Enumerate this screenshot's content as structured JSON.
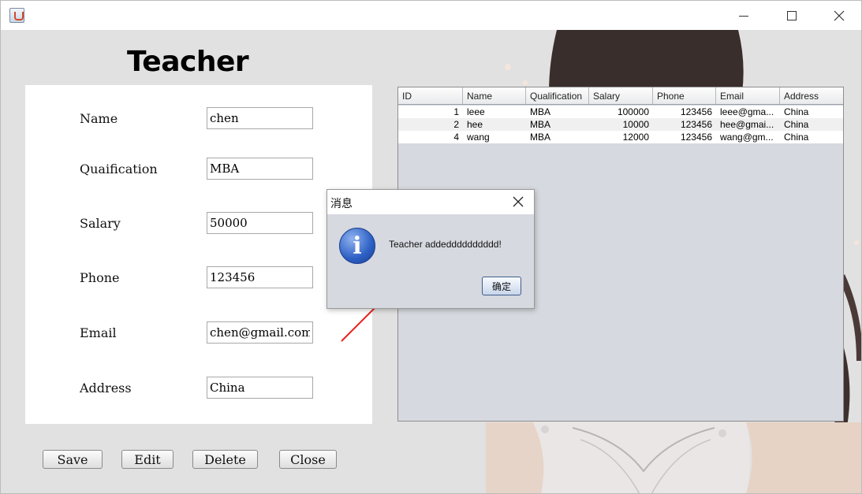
{
  "window": {
    "icon": "java-cup-icon",
    "controls": [
      "minimize-icon",
      "maximize-icon",
      "close-icon"
    ]
  },
  "page": {
    "title": "Teacher"
  },
  "form": {
    "fields": [
      {
        "label": "Name",
        "value": "chen"
      },
      {
        "label": "Quaification",
        "value": "MBA"
      },
      {
        "label": "Salary",
        "value": "50000"
      },
      {
        "label": "Phone",
        "value": "123456"
      },
      {
        "label": "Email",
        "value": "chen@gmail.com"
      },
      {
        "label": "Address",
        "value": "China"
      }
    ]
  },
  "buttons": {
    "save": "Save",
    "edit": "Edit",
    "delete": "Delete",
    "close": "Close"
  },
  "table": {
    "columns": [
      "ID",
      "Name",
      "Qualification",
      "Salary",
      "Phone",
      "Email",
      "Address"
    ],
    "rows": [
      [
        "1",
        "leee",
        "MBA",
        "100000",
        "123456",
        "leee@gma...",
        "China"
      ],
      [
        "2",
        "hee",
        "MBA",
        "10000",
        "123456",
        "hee@gmai...",
        "China"
      ],
      [
        "4",
        "wang",
        "MBA",
        "12000",
        "123456",
        "wang@gm...",
        "China"
      ]
    ]
  },
  "dialog": {
    "title": "消息",
    "icon": "information-icon",
    "message": "Teacher addedddddddddd!",
    "ok_label": "确定"
  },
  "annotation": {
    "color": "#e8231f"
  }
}
